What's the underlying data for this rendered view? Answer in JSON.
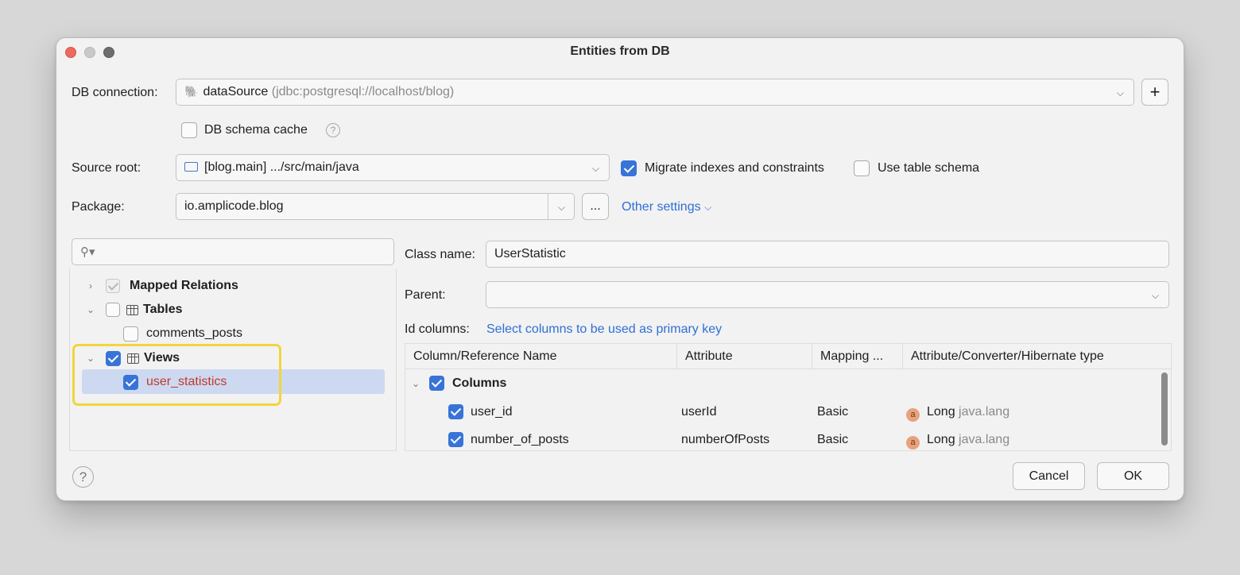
{
  "window": {
    "title": "Entities from DB"
  },
  "db_connection": {
    "label": "DB connection:",
    "name": "dataSource",
    "url": "(jdbc:postgresql://localhost/blog)",
    "add_button": "+"
  },
  "schema_cache": {
    "label": "DB schema cache",
    "checked": false
  },
  "source_root": {
    "label": "Source root:",
    "value": "[blog.main] .../src/main/java"
  },
  "migrate_indexes": {
    "label": "Migrate indexes and constraints",
    "checked": true
  },
  "use_table_schema": {
    "label": "Use table schema",
    "checked": false
  },
  "package": {
    "label": "Package:",
    "value": "io.amplicode.blog",
    "browse_label": "...",
    "other_settings": "Other settings"
  },
  "search": {
    "placeholder": ""
  },
  "tree": {
    "mapped_relations": "Mapped Relations",
    "tables": "Tables",
    "comments_posts": "comments_posts",
    "views": "Views",
    "user_statistics": "user_statistics"
  },
  "class_name": {
    "label": "Class name:",
    "value": "UserStatistic"
  },
  "parent": {
    "label": "Parent:",
    "value": ""
  },
  "id_columns": {
    "label": "Id columns:",
    "link": "Select columns to be used as primary key"
  },
  "columns_table": {
    "headers": [
      "Column/Reference Name",
      "Attribute",
      "Mapping ...",
      "Attribute/Converter/Hibernate type"
    ],
    "group": "Columns",
    "rows": [
      {
        "name": "user_id",
        "attribute": "userId",
        "mapping": "Basic",
        "type": "Long",
        "pkg": "java.lang"
      },
      {
        "name": "number_of_posts",
        "attribute": "numberOfPosts",
        "mapping": "Basic",
        "type": "Long",
        "pkg": "java.lang"
      }
    ]
  },
  "buttons": {
    "help": "?",
    "cancel": "Cancel",
    "ok": "OK"
  },
  "colors": {
    "accent": "#3874d8",
    "highlight": "#f2d53c",
    "link": "#2f6fd6"
  }
}
